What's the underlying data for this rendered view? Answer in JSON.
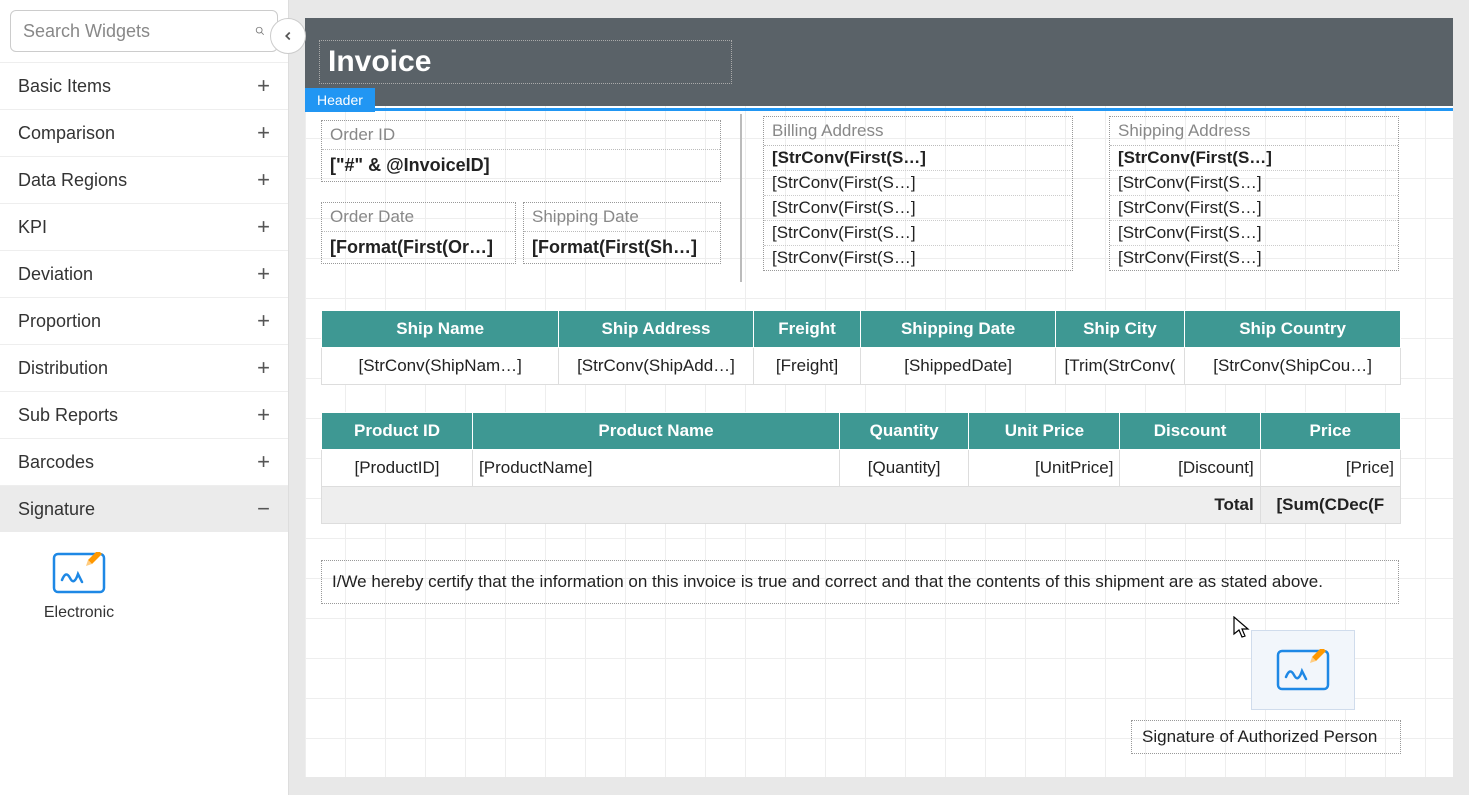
{
  "sidebar": {
    "search_placeholder": "Search Widgets",
    "categories": [
      {
        "label": "Basic Items",
        "expanded": false
      },
      {
        "label": "Comparison",
        "expanded": false
      },
      {
        "label": "Data Regions",
        "expanded": false
      },
      {
        "label": "KPI",
        "expanded": false
      },
      {
        "label": "Deviation",
        "expanded": false
      },
      {
        "label": "Proportion",
        "expanded": false
      },
      {
        "label": "Distribution",
        "expanded": false
      },
      {
        "label": "Sub Reports",
        "expanded": false
      },
      {
        "label": "Barcodes",
        "expanded": false
      },
      {
        "label": "Signature",
        "expanded": true
      }
    ],
    "signature_widget": "Electronic"
  },
  "header": {
    "title": "Invoice",
    "tab_label": "Header"
  },
  "fields": {
    "order_id": {
      "label": "Order ID",
      "value": "[\"#\" & @InvoiceID]"
    },
    "order_date": {
      "label": "Order Date",
      "value": "[Format(First(Or…]"
    },
    "shipping_date": {
      "label": "Shipping Date",
      "value": "[Format(First(Sh…]"
    }
  },
  "billing": {
    "label": "Billing Address",
    "lines": [
      "[StrConv(First(S…]",
      "[StrConv(First(S…]",
      "[StrConv(First(S…]",
      "[StrConv(First(S…]",
      "[StrConv(First(S…]"
    ]
  },
  "shipping": {
    "label": "Shipping Address",
    "lines": [
      "[StrConv(First(S…]",
      "[StrConv(First(S…]",
      "[StrConv(First(S…]",
      "[StrConv(First(S…]",
      "[StrConv(First(S…]"
    ]
  },
  "ship_table": {
    "headers": [
      "Ship Name",
      "Ship Address",
      "Freight",
      "Shipping Date",
      "Ship City",
      "Ship Country"
    ],
    "row": [
      "[StrConv(ShipNam…]",
      "[StrConv(ShipAdd…]",
      "[Freight]",
      "[ShippedDate]",
      "[Trim(StrConv(",
      "[StrConv(ShipCou…]"
    ]
  },
  "product_table": {
    "headers": [
      "Product ID",
      "Product Name",
      "Quantity",
      "Unit Price",
      "Discount",
      "Price"
    ],
    "row": [
      "[ProductID]",
      "[ProductName]",
      "[Quantity]",
      "[UnitPrice]",
      "[Discount]",
      "[Price]"
    ],
    "total_label": "Total",
    "total_value": "[Sum(CDec(F"
  },
  "certification": "I/We hereby certify that the information on this invoice is true and correct and that the contents of this shipment are as stated above.",
  "signature_caption": "Signature of Authorized Person"
}
